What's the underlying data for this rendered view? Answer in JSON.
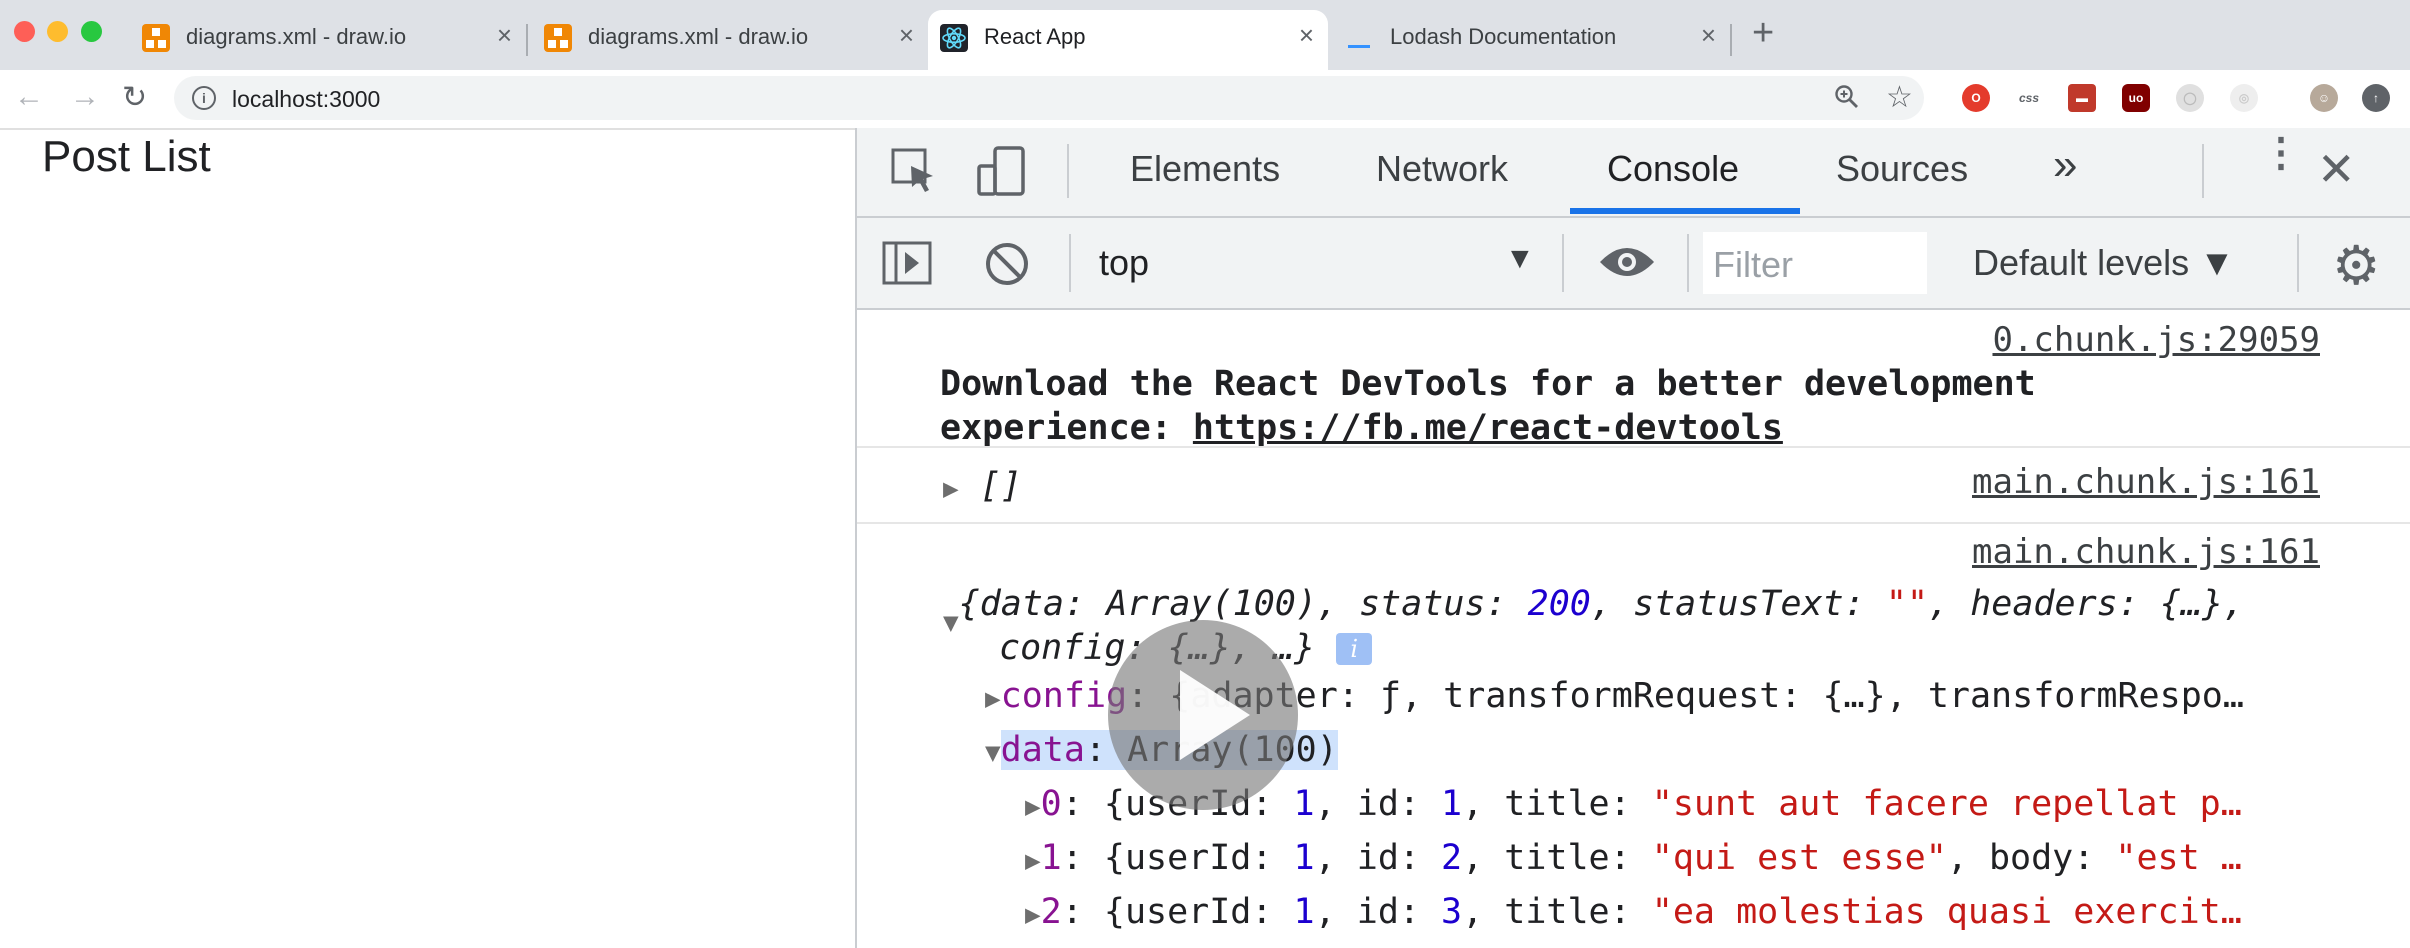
{
  "browser": {
    "tabs": [
      {
        "title": "diagrams.xml - draw.io",
        "icon": "drawio-icon",
        "active": false
      },
      {
        "title": "diagrams.xml - draw.io",
        "icon": "drawio-icon",
        "active": false
      },
      {
        "title": "React App",
        "icon": "react-icon",
        "active": true
      },
      {
        "title": "Lodash Documentation",
        "icon": "lodash-icon",
        "active": false
      }
    ],
    "close_glyph": "×",
    "new_tab_glyph": "+",
    "url": "localhost:3000"
  },
  "page": {
    "title": "Post List"
  },
  "devtools": {
    "tabs": [
      "Elements",
      "Network",
      "Console",
      "Sources"
    ],
    "active_tab": "Console",
    "more_glyph": "»",
    "context": "top",
    "filter_placeholder": "Filter",
    "levels_label": "Default levels ▼",
    "accent": "#1a73e8",
    "console": {
      "msg1": {
        "source": "0.chunk.js:29059",
        "line1": "Download the React DevTools for a better development",
        "line2_prefix": "experience: ",
        "line2_link": "https://fb.me/react-devtools"
      },
      "msg2": {
        "source": "main.chunk.js:161",
        "text": "[]"
      },
      "msg3": {
        "source": "main.chunk.js:161",
        "summary_data_key": "data",
        "summary_data_val": "Array(100)",
        "summary_status_key": "status",
        "summary_status_val": "200",
        "summary_statusText_key": "statusText",
        "summary_statusText_val": "\"\"",
        "summary_headers_key": "headers",
        "summary_headers_val": "{…}",
        "summary_config_key": "config",
        "summary_config_val": "{…}",
        "summary_more": "…",
        "info_badge": "i",
        "config_row_key": "config",
        "config_row_rest": "{adapter: ƒ, transformRequest: {…}, transformRespo…",
        "data_row_key": "data",
        "data_row_val": "Array(100)",
        "items": [
          {
            "index": "0",
            "userId": "1",
            "id": "1",
            "title": "\"sunt aut facere repellat p…"
          },
          {
            "index": "1",
            "userId": "1",
            "id": "2",
            "title": "\"qui est esse\"",
            "body_key": "body",
            "body_val": "\"est …"
          },
          {
            "index": "2",
            "userId": "1",
            "id": "3",
            "title": "\"ea molestias quasi exercit…"
          }
        ]
      }
    }
  }
}
